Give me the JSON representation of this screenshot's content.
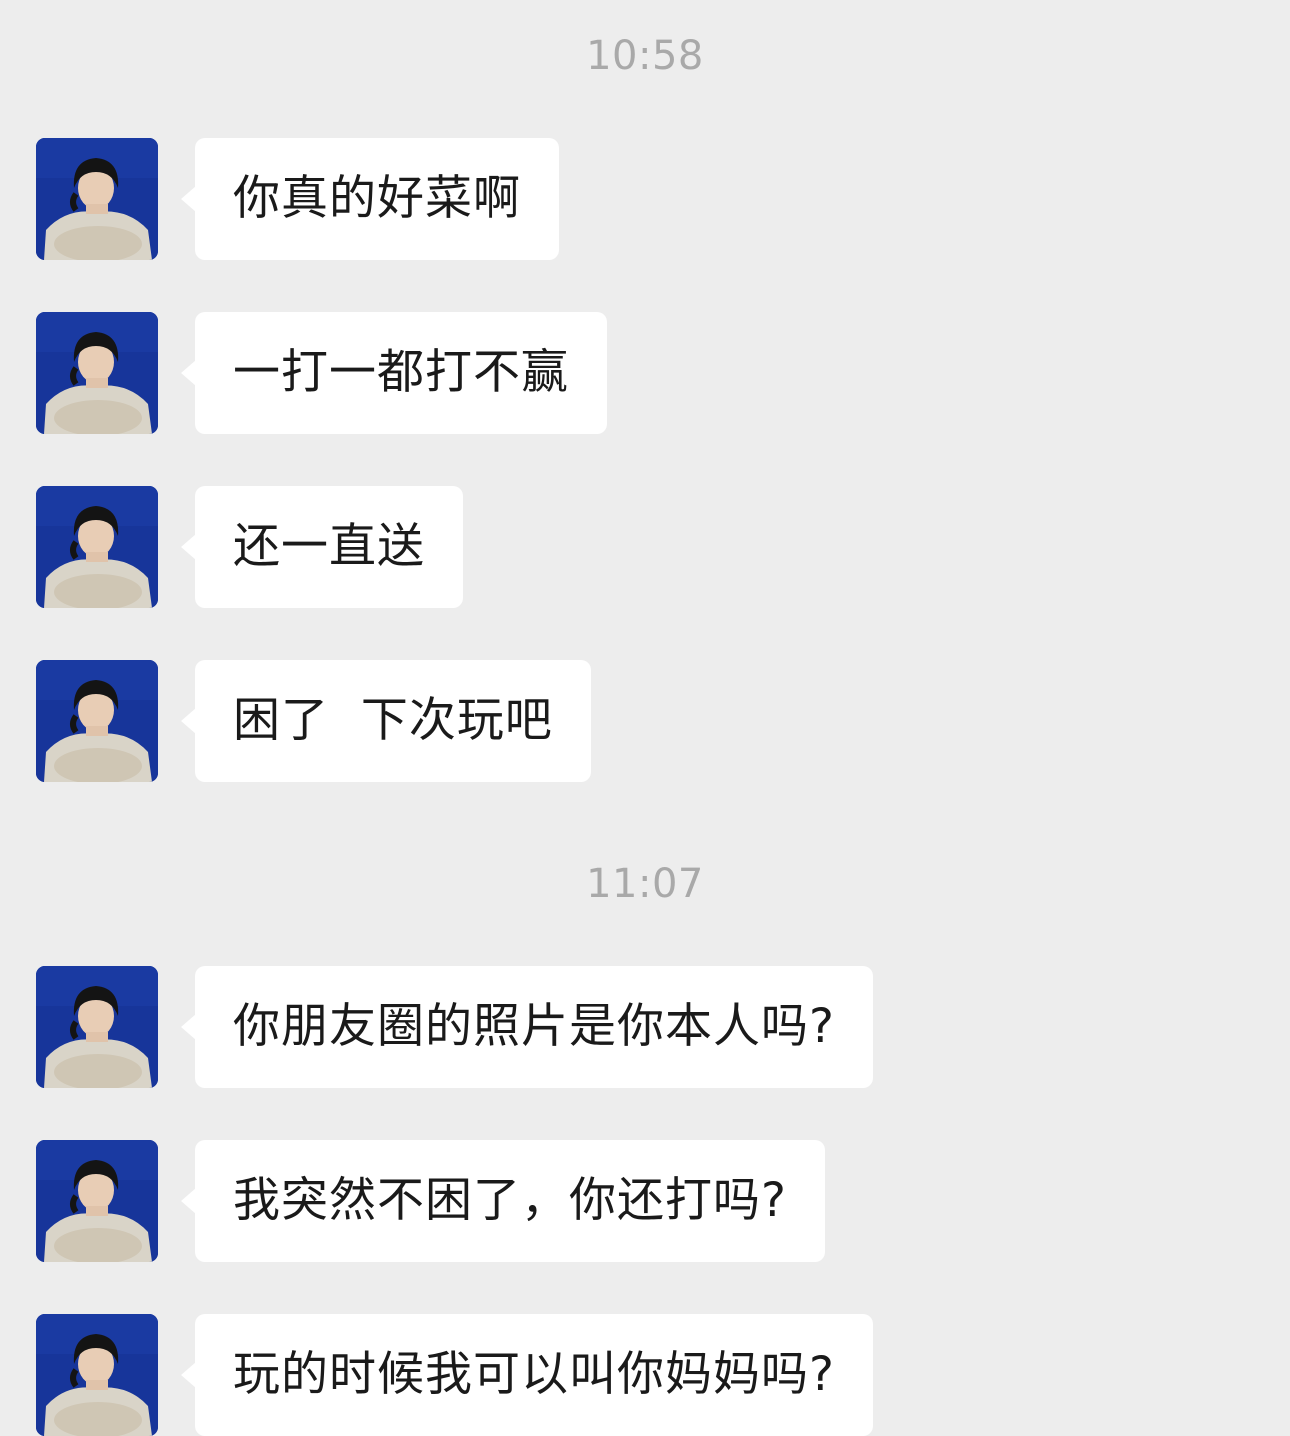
{
  "chat": {
    "timestamps": [
      "10:58",
      "11:07"
    ],
    "messages": [
      {
        "text": "你真的好菜啊"
      },
      {
        "text": "一打一都打不赢"
      },
      {
        "text": "还一直送"
      },
      {
        "text": "困了  下次玩吧"
      },
      {
        "text": "你朋友圈的照片是你本人吗?"
      },
      {
        "text": "我突然不困了，你还打吗?"
      },
      {
        "text": "玩的时候我可以叫你妈妈吗?"
      }
    ]
  },
  "colors": {
    "background": "#ededed",
    "bubble": "#ffffff",
    "timestamp": "#a9a9a9",
    "text": "#1a1a1a",
    "avatar_background": "#17359a"
  },
  "icons": {
    "avatar": "avatar-icon"
  }
}
